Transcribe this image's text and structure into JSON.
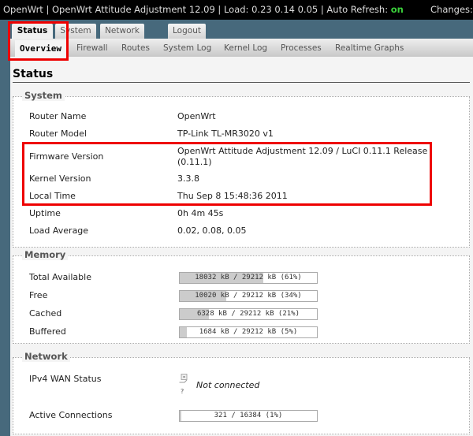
{
  "header": {
    "hostname": "OpenWrt",
    "firmware": "OpenWrt Attitude Adjustment 12.09",
    "load_label": "Load:",
    "load": "0.23 0.14 0.05",
    "auto_refresh_label": "Auto Refresh:",
    "auto_refresh_value": "on",
    "changes_label": "Changes:"
  },
  "main_tabs": [
    {
      "label": "Status",
      "active": true
    },
    {
      "label": "System",
      "active": false
    },
    {
      "label": "Network",
      "active": false
    },
    {
      "label": "Logout",
      "active": false
    }
  ],
  "sub_tabs": [
    {
      "label": "Overview",
      "active": true
    },
    {
      "label": "Firewall",
      "active": false
    },
    {
      "label": "Routes",
      "active": false
    },
    {
      "label": "System Log",
      "active": false
    },
    {
      "label": "Kernel Log",
      "active": false
    },
    {
      "label": "Processes",
      "active": false
    },
    {
      "label": "Realtime Graphs",
      "active": false
    }
  ],
  "page_title": "Status",
  "system": {
    "legend": "System",
    "rows": [
      {
        "label": "Router Name",
        "value": "OpenWrt"
      },
      {
        "label": "Router Model",
        "value": "TP-Link TL-MR3020 v1"
      },
      {
        "label": "Firmware Version",
        "value": "OpenWrt Attitude Adjustment 12.09 / LuCI 0.11.1 Release (0.11.1)"
      },
      {
        "label": "Kernel Version",
        "value": "3.3.8"
      },
      {
        "label": "Local Time",
        "value": "Thu Sep 8 15:48:36 2011"
      },
      {
        "label": "Uptime",
        "value": "0h 4m 45s"
      },
      {
        "label": "Load Average",
        "value": "0.02, 0.08, 0.05"
      }
    ]
  },
  "memory": {
    "legend": "Memory",
    "rows": [
      {
        "label": "Total Available",
        "text": "18032 kB / 29212 kB (61%)",
        "percent": 61
      },
      {
        "label": "Free",
        "text": "10020 kB / 29212 kB (34%)",
        "percent": 34
      },
      {
        "label": "Cached",
        "text": "6328 kB / 29212 kB (21%)",
        "percent": 21
      },
      {
        "label": "Buffered",
        "text": "1684 kB / 29212 kB (5%)",
        "percent": 5
      }
    ]
  },
  "network": {
    "legend": "Network",
    "wan_label": "IPv4 WAN Status",
    "wan_icon": "network-disconnected-icon",
    "wan_icon_caption": "?",
    "wan_status": "Not connected",
    "connections_label": "Active Connections",
    "connections_text": "321 / 16384 (1%)",
    "connections_percent": 1
  },
  "colors": {
    "highlight": "#e00000",
    "auto_refresh_on": "#3bd13b",
    "bar_fill": "#cccccc"
  }
}
